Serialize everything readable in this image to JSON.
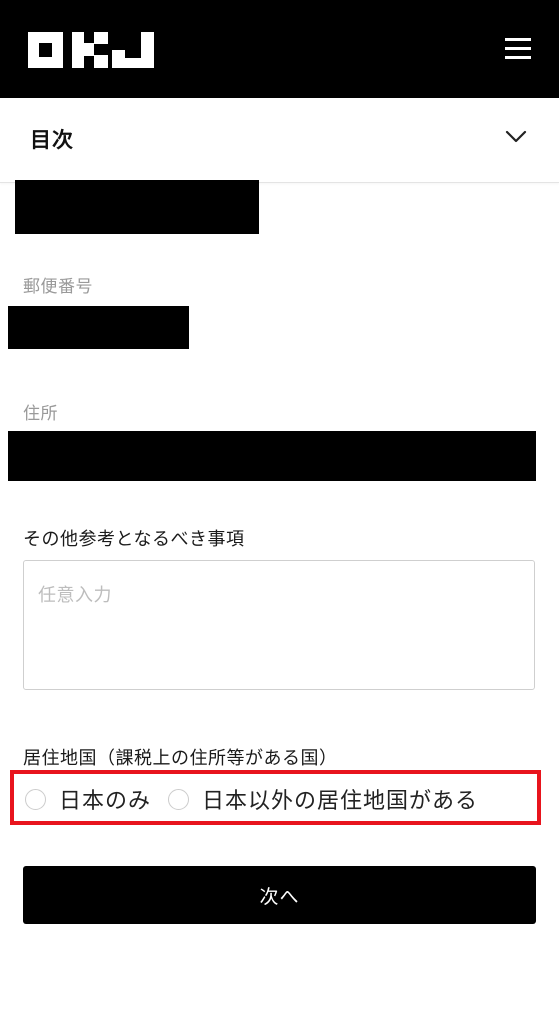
{
  "header": {
    "logo_text": "OKJ",
    "menu_icon": "hamburger-menu-icon"
  },
  "toc": {
    "title": "目次",
    "toggle_icon": "chevron-down-icon"
  },
  "form": {
    "postal_code_label": "郵便番号",
    "address_label": "住所",
    "remarks_label": "その他参考となるべき事項",
    "remarks_placeholder": "任意入力",
    "residence_label": "居住地国（課税上の住所等がある国）",
    "residence_options": [
      {
        "label": "日本のみ",
        "selected": false
      },
      {
        "label": "日本以外の居住地国がある",
        "selected": false
      }
    ],
    "next_button": "次へ"
  },
  "colors": {
    "header_bg": "#000000",
    "highlight_border": "#e8141d",
    "button_bg": "#000000"
  }
}
